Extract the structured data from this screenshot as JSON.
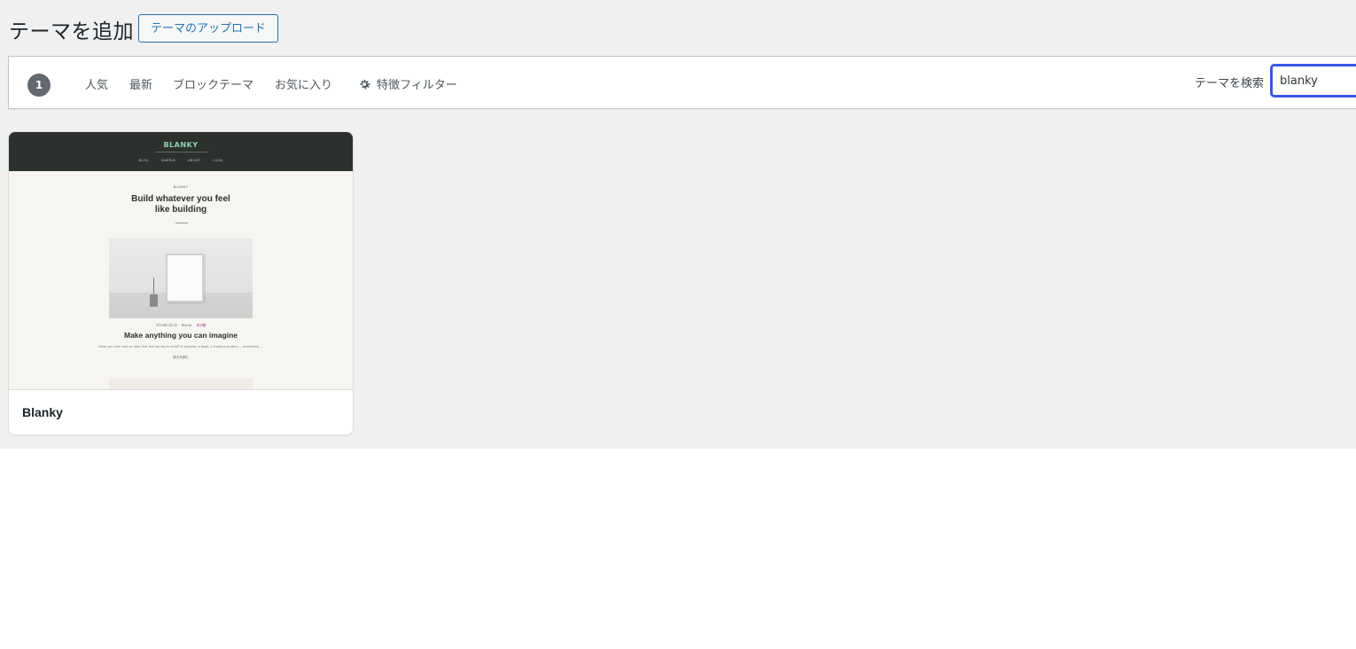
{
  "header": {
    "title": "テーマを追加",
    "upload_button": "テーマのアップロード"
  },
  "filter_bar": {
    "count": "1",
    "tabs": [
      {
        "label": "人気"
      },
      {
        "label": "最新"
      },
      {
        "label": "ブロックテーマ"
      },
      {
        "label": "お気に入り"
      }
    ],
    "feature_filter": {
      "label": "特徴フィルター",
      "icon": "gear-icon"
    },
    "search": {
      "label": "テーマを検索",
      "value": "blanky"
    }
  },
  "themes": [
    {
      "name": "Blanky",
      "screenshot": {
        "logo": "BLANKY",
        "nav": [
          "BLOG",
          "SAMPLE",
          "ABOUT",
          "LOGS"
        ],
        "kicker": "BLANKY",
        "headline_line1": "Build whatever you feel",
        "headline_line2": "like building",
        "post_meta": [
          "2024年1月1日",
          "Blanky",
          "未分類"
        ],
        "post_title": "Make anything you can imagine",
        "excerpt": "Have you ever had an idea that felt too big to build? A website, a book, a creative project — something …",
        "more": "続きを読む"
      }
    }
  ],
  "colors": {
    "background": "#f0f0f1",
    "accent": "#2271b1",
    "focus": "#3858e9",
    "count_badge": "#646970",
    "preview_header": "#2c312e",
    "preview_logo": "#8fd0b4"
  }
}
